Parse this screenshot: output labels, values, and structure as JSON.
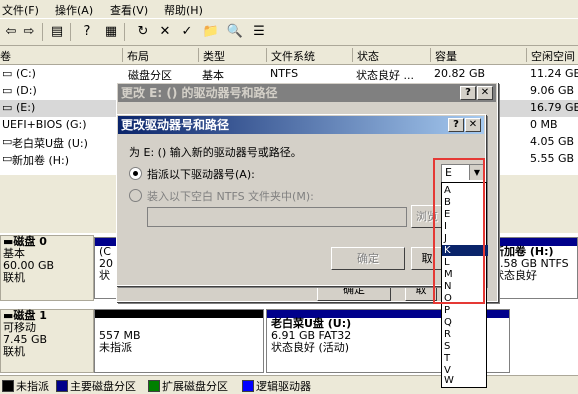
{
  "menu": [
    "文件(F)",
    "操作(A)",
    "查看(V)",
    "帮助(H)"
  ],
  "columns": [
    "卷",
    "布局",
    "类型",
    "文件系统",
    "状态",
    "容量",
    "空闲空间"
  ],
  "volumes": [
    {
      "name": "(C:)",
      "layout": "磁盘分区",
      "type": "基本",
      "fs": "NTFS",
      "status": "状态良好 ...",
      "capacity": "20.82 GB",
      "free": "11.24 GB"
    },
    {
      "name": "(D:)",
      "layout": "",
      "type": "",
      "fs": "",
      "status": "",
      "capacity": "",
      "free": "9.06 GB"
    },
    {
      "name": "(E:)",
      "layout": "",
      "type": "",
      "fs": "",
      "status": "",
      "capacity": "",
      "free": "16.79 GB"
    },
    {
      "name": "UEFI+BIOS (G:)",
      "layout": "",
      "type": "",
      "fs": "",
      "status": "",
      "capacity": "",
      "free": "0 MB"
    },
    {
      "name": "老白菜U盘 (U:)",
      "layout": "",
      "type": "",
      "fs": "",
      "status": "",
      "capacity": "",
      "free": "4.05 GB"
    },
    {
      "name": "新加卷 (H:)",
      "layout": "",
      "type": "",
      "fs": "",
      "status": "",
      "capacity": "",
      "free": "5.55 GB"
    }
  ],
  "disk0": {
    "name": "磁盘 0",
    "type": "基本",
    "size": "60.00 GB",
    "state": "联机",
    "p1_line1": "(C",
    "p1_line2": "20",
    "p1_line3": "状",
    "p_right_title": "新加卷 (H:)",
    "p_right_size": "5.58 GB NTFS",
    "p_right_state": "状态良好"
  },
  "disk1": {
    "name": "磁盘 1",
    "type": "可移动",
    "size": "7.45 GB",
    "state": "联机",
    "unalloc_size": "557 MB",
    "unalloc_label": "未指派",
    "usb_title": "老白菜U盘  (U:)",
    "usb_size": "6.91 GB FAT32",
    "usb_state": "状态良好 (活动)"
  },
  "legend": [
    "未指派",
    "主要磁盘分区",
    "扩展磁盘分区",
    "逻辑驱动器"
  ],
  "colors": {
    "unassigned": "#000000",
    "primary": "#00008b",
    "extended": "#008000",
    "logical": "#0000ff",
    "highlight": "#e53935"
  },
  "dialog_outer": {
    "title": "更改 E: () 的驱动器号和路径",
    "ok": "确定",
    "cancel_partial": "取",
    "help_btn": "?",
    "close_btn": "✕"
  },
  "dialog_inner": {
    "title": "更改驱动器号和路径",
    "prompt": "为 E: () 输入新的驱动器号或路径。",
    "opt_letter": "指派以下驱动器号(A):",
    "opt_folder": "装入以下空白 NTFS 文件夹中(M):",
    "browse": "浏览",
    "ok": "确定",
    "cancel_partial": "取",
    "ok_bottom": "确定",
    "cancel_bottom_partial": "取",
    "help_btn": "?",
    "close_btn": "✕",
    "selected_letter": "E"
  },
  "letters": [
    "A",
    "B",
    "E",
    "I",
    "J",
    "K",
    "L",
    "M",
    "N",
    "O",
    "P",
    "Q",
    "R",
    "S",
    "T",
    "V",
    "W"
  ],
  "highlighted_letter": "K"
}
